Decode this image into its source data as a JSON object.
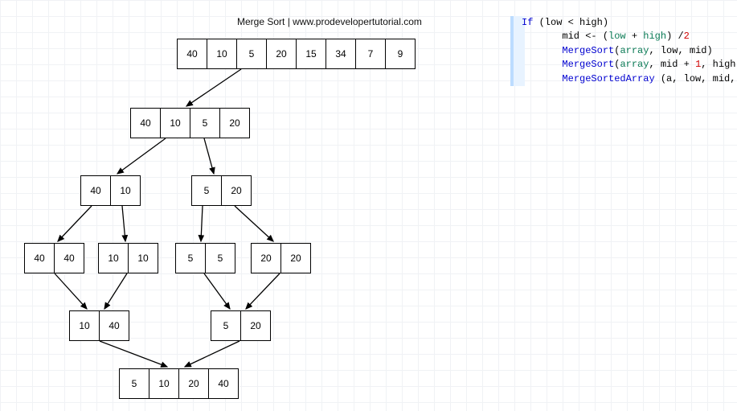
{
  "title": "Merge Sort | www.prodevelopertutorial.com",
  "rows": {
    "r0": [
      "40",
      "10",
      "5",
      "20",
      "15",
      "34",
      "7",
      "9"
    ],
    "r1": [
      "40",
      "10",
      "5",
      "20"
    ],
    "r2a": [
      "40",
      "10"
    ],
    "r2b": [
      "5",
      "20"
    ],
    "r3a": [
      "40",
      "40"
    ],
    "r3b": [
      "10",
      "10"
    ],
    "r3c": [
      "5",
      "5"
    ],
    "r3d": [
      "20",
      "20"
    ],
    "r4a": [
      "10",
      "40"
    ],
    "r4b": [
      "5",
      "20"
    ],
    "r5": [
      "5",
      "10",
      "20",
      "40"
    ]
  },
  "code": {
    "l1a": "If ",
    "l1b": "(low ",
    "l1c": "< ",
    "l1d": "high",
    "l2a": "       mid ",
    "l2b": "<- (",
    "l2c": "low ",
    "l2d": "+ ",
    "l2e": "high",
    ")": ") /",
    "l2f": "2",
    "l3a": "       ",
    "l3b": "MergeSort",
    "l3c": "(",
    "l3d": "array",
    "l3e": ", low, mid)",
    "l4a": "       ",
    "l4b": "MergeSort",
    "l4c": "(",
    "l4d": "array",
    "l4e": ", mid + ",
    "l4f": "1",
    "l4g": ", high)",
    "l5a": "       ",
    "l5b": "MergeSortedArray ",
    "l5c": "(a, low, mid, "
  }
}
